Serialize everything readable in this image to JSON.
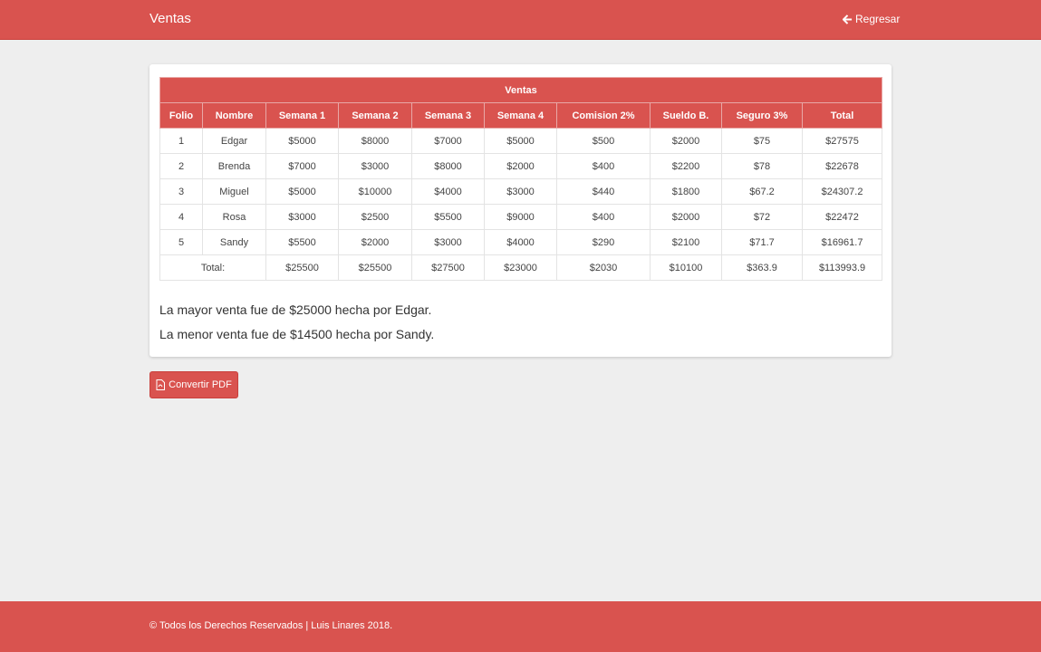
{
  "navbar": {
    "brand": "Ventas",
    "back_label": "Regresar",
    "back_icon": "arrow-left-icon"
  },
  "table": {
    "title": "Ventas",
    "headers": [
      "Folio",
      "Nombre",
      "Semana 1",
      "Semana 2",
      "Semana 3",
      "Semana 4",
      "Comision 2%",
      "Sueldo B.",
      "Seguro 3%",
      "Total"
    ],
    "rows": [
      [
        "1",
        "Edgar",
        "$5000",
        "$8000",
        "$7000",
        "$5000",
        "$500",
        "$2000",
        "$75",
        "$27575"
      ],
      [
        "2",
        "Brenda",
        "$7000",
        "$3000",
        "$8000",
        "$2000",
        "$400",
        "$2200",
        "$78",
        "$22678"
      ],
      [
        "3",
        "Miguel",
        "$5000",
        "$10000",
        "$4000",
        "$3000",
        "$440",
        "$1800",
        "$67.2",
        "$24307.2"
      ],
      [
        "4",
        "Rosa",
        "$3000",
        "$2500",
        "$5500",
        "$9000",
        "$400",
        "$2000",
        "$72",
        "$22472"
      ],
      [
        "5",
        "Sandy",
        "$5500",
        "$2000",
        "$3000",
        "$4000",
        "$290",
        "$2100",
        "$71.7",
        "$16961.7"
      ]
    ],
    "totals_label": "Total:",
    "totals": [
      "$25500",
      "$25500",
      "$27500",
      "$23000",
      "$2030",
      "$10100",
      "$363.9",
      "$113993.9"
    ]
  },
  "summary": {
    "max_sale": "La mayor venta fue de $25000 hecha por Edgar.",
    "min_sale": "La menor venta fue de $14500 hecha por Sandy."
  },
  "actions": {
    "pdf_label": "Convertir PDF",
    "pdf_icon": "file-pdf-icon"
  },
  "footer": {
    "text": "© Todos los Derechos Reservados | Luis Linares 2018."
  },
  "colors": {
    "accent": "#d9534f",
    "background": "#eeeeee"
  }
}
